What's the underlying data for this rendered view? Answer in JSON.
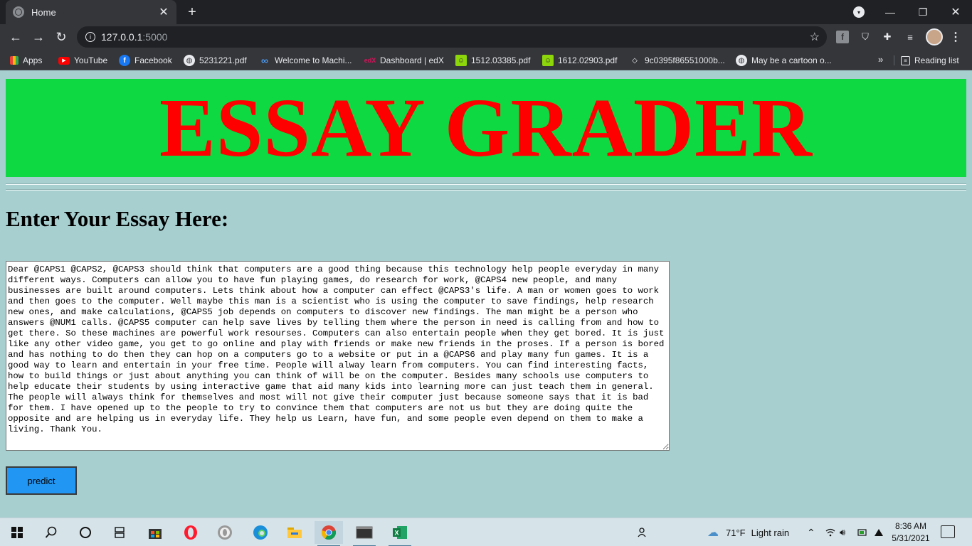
{
  "browser": {
    "tab_title": "Home",
    "url_host": "127.0.0.1",
    "url_port": ":5000",
    "bookmarks": [
      {
        "label": "Apps",
        "icon": "apps-grid-icon"
      },
      {
        "label": "YouTube",
        "icon": "youtube-icon"
      },
      {
        "label": "Facebook",
        "icon": "facebook-icon"
      },
      {
        "label": "5231221.pdf",
        "icon": "globe-icon"
      },
      {
        "label": "Welcome to Machi...",
        "icon": "coursera-icon"
      },
      {
        "label": "Dashboard | edX",
        "icon": "edx-icon"
      },
      {
        "label": "1512.03385.pdf",
        "icon": "pdf-smiley-icon"
      },
      {
        "label": "1612.02903.pdf",
        "icon": "pdf-smiley-icon"
      },
      {
        "label": "9c0395f86551000b...",
        "icon": "gem-icon"
      },
      {
        "label": "May be a cartoon o...",
        "icon": "globe-icon"
      }
    ],
    "more_bookmarks": "»",
    "reading_list": "Reading list"
  },
  "page": {
    "banner_title": "ESSAY GRADER",
    "heading": "Enter Your Essay Here:",
    "essay_text": "Dear @CAPS1 @CAPS2, @CAPS3 should think that computers are a good thing because this technology help people everyday in many different ways. Computers can allow you to have fun playing games, do research for work, @CAPS4 new people, and many businesses are built around computers. Lets think about how a computer can effect @CAPS3's life. A man or women goes to work and then goes to the computer. Well maybe this man is a scientist who is using the computer to save findings, help research new ones, and make calculations, @CAPS5 job depends on computers to discover new findings. The man might be a person who answers @NUM1 calls. @CAPS5 computer can help save lives by telling them where the person in need is calling from and how to get there. So these machines are powerful work resourses. Computers can also entertain people when they get bored. It is just like any other video game, you get to go online and play with friends or make new friends in the proses. If a person is bored and has nothing to do then they can hop on a computers go to a website or put in a @CAPS6 and play many fun games. It is a good way to learn and entertain in your free time. People will alway learn from computers. You can find interesting facts, how to build things or just about anything you can think of will be on the computer. Besides many schools use computers to help educate their students by using interactive game that aid many kids into learning more can just teach them in general. The people will always think for themselves and most will not give their computer just because someone says that it is bad for them. I have opened up to the people to try to convince them that computers are not us but they are doing quite the opposite and are helping us in everyday life. They help us Learn, have fun, and some people even depend on them to make a living. Thank You.",
    "predict_label": "predict"
  },
  "taskbar": {
    "weather_temp": "71°F",
    "weather_desc": "Light rain",
    "time": "8:36 AM",
    "date": "5/31/2021"
  },
  "colors": {
    "banner_bg": "#0fd942",
    "banner_text": "#ff0000",
    "page_bg": "#a7cfd0",
    "button_bg": "#2196f3"
  }
}
